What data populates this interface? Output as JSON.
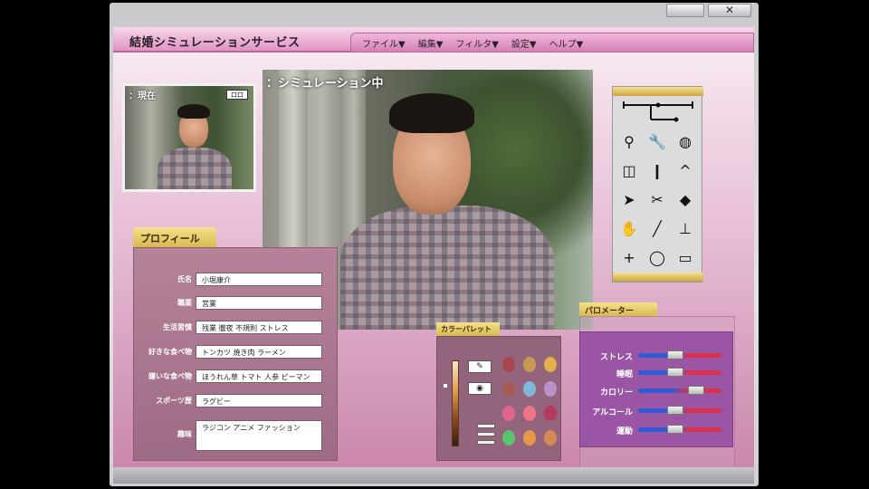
{
  "window": {
    "close_glyph": "✕"
  },
  "app": {
    "title": "結婚シミュレーションサービス",
    "menu": [
      "ファイル▼",
      "編集▼",
      "フィルタ▼",
      "設定▼",
      "ヘルプ▼"
    ]
  },
  "current_photo": {
    "label": "：現在",
    "badge": "口口"
  },
  "main_photo": {
    "label": "：シミュレーション中"
  },
  "profile": {
    "tab": "プロフィール",
    "fields": [
      {
        "label": "氏名",
        "value": "小堀康介"
      },
      {
        "label": "職業",
        "value": "営業"
      },
      {
        "label": "生活習慣",
        "value": "残業 徹夜 不規則 ストレス"
      },
      {
        "label": "好きな食べ物",
        "value": "トンカツ 焼き肉 ラーメン"
      },
      {
        "label": "嫌いな食べ物",
        "value": "ほうれん草 トマト 人参 ピーマン"
      },
      {
        "label": "スポーツ歴",
        "value": "ラグビー"
      },
      {
        "label": "趣味",
        "value": "ラジコン アニメ ファッション"
      }
    ]
  },
  "palette": {
    "tab": "カラーパレット",
    "swatch_colors": [
      "#a9454f",
      "#c49a55",
      "#e3b04a",
      "#a55a55",
      "#7fb7d6",
      "#b892c9",
      "#e0668f",
      "#f07488",
      "#b43a5f",
      "#5bc46e",
      "#e69a49",
      "#d48a55"
    ],
    "gradient_colors": [
      "#f7e7c4",
      "#e3a052",
      "#8b4f1c",
      "#3a1f0d"
    ]
  },
  "parameters": {
    "tab": "パロメーター",
    "items": [
      {
        "label": "ストレス",
        "level": 0.45
      },
      {
        "label": "睡眠",
        "level": 0.45
      },
      {
        "label": "カロリー",
        "level": 0.7
      },
      {
        "label": "アルコール",
        "level": 0.45
      },
      {
        "label": "運動",
        "level": 0.45
      }
    ]
  },
  "toolbox": {
    "tools": [
      {
        "name": "magnifier-icon",
        "glyph": "⚲"
      },
      {
        "name": "wrench-icon",
        "glyph": "🔧"
      },
      {
        "name": "blob-brush-icon",
        "glyph": "◍"
      },
      {
        "name": "glasses-icon",
        "glyph": "◫"
      },
      {
        "name": "dropper-icon",
        "glyph": "❙"
      },
      {
        "name": "chevron-up-icon",
        "glyph": "^"
      },
      {
        "name": "arrow-pointer-icon",
        "glyph": "➤"
      },
      {
        "name": "scissors-icon",
        "glyph": "✂"
      },
      {
        "name": "eraser-icon",
        "glyph": "◆"
      },
      {
        "name": "hand-icon",
        "glyph": "✋"
      },
      {
        "name": "pen-icon",
        "glyph": "╱"
      },
      {
        "name": "bucket-icon",
        "glyph": "⊥"
      },
      {
        "name": "plus-icon",
        "glyph": "+"
      },
      {
        "name": "ellipse-select-icon",
        "glyph": "◯"
      },
      {
        "name": "rect-select-icon",
        "glyph": "▭"
      }
    ]
  }
}
